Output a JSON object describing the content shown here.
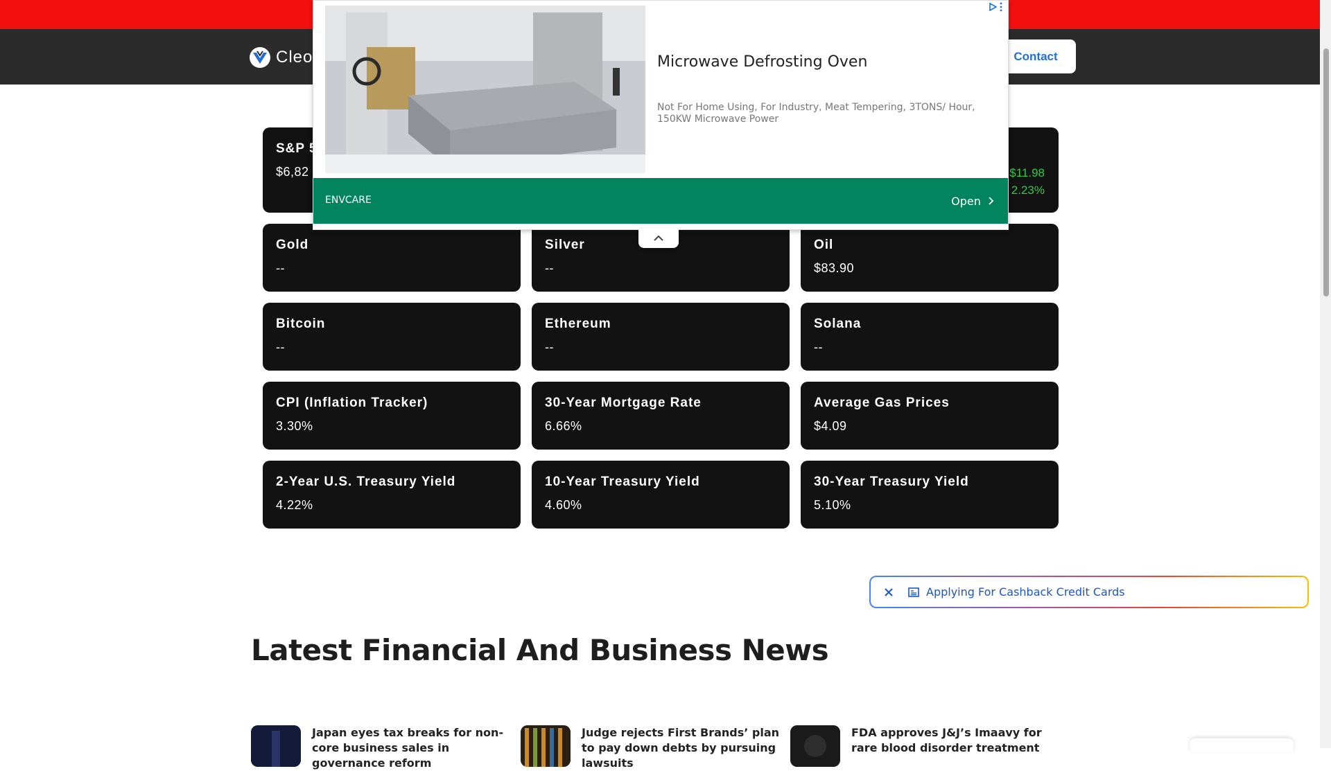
{
  "header": {
    "logo_text": "Cleo",
    "contact_label": "Contact"
  },
  "cards": [
    {
      "title": "S&P 5",
      "value": "$6,82",
      "change": ""
    },
    {
      "title": "",
      "value": "",
      "change": ""
    },
    {
      "title": "",
      "value": "",
      "change_line1": "$11.98",
      "change_line2": "2.23%"
    },
    {
      "title": "Gold",
      "value": "--"
    },
    {
      "title": "Silver",
      "value": "--"
    },
    {
      "title": "Oil",
      "value": "$83.90"
    },
    {
      "title": "Bitcoin",
      "value": "--"
    },
    {
      "title": "Ethereum",
      "value": "--"
    },
    {
      "title": "Solana",
      "value": "--"
    },
    {
      "title": "CPI (Inflation Tracker)",
      "value": "3.30%"
    },
    {
      "title": "30-Year Mortgage Rate",
      "value": "6.66%"
    },
    {
      "title": "Average Gas Prices",
      "value": "$4.09"
    },
    {
      "title": "2-Year U.S. Treasury Yield",
      "value": "4.22%"
    },
    {
      "title": "10-Year Treasury Yield",
      "value": "4.60%"
    },
    {
      "title": "30-Year Treasury Yield",
      "value": "5.10%"
    }
  ],
  "ad": {
    "title": "Microwave Defrosting Oven",
    "description": "Not For Home Using, For Industry, Meat Tempering, 3TONS/ Hour, 150KW Microwave Power",
    "brand": "ENVCARE",
    "open_label": "Open"
  },
  "suggestion": {
    "text": "Applying For Cashback Credit Cards"
  },
  "news": {
    "heading": "Latest Financial And Business News",
    "items": [
      {
        "headline": "Japan eyes tax breaks for non-core business sales in governance reform"
      },
      {
        "headline": "Judge rejects First Brands’ plan to pay down debts by pursuing lawsuits"
      },
      {
        "headline": "FDA approves J&J’s Imaavy for rare blood disorder treatment"
      }
    ]
  },
  "colors": {
    "topbar": "#f40f0f",
    "navbar": "#2b2b2b",
    "card_bg": "#121212",
    "positive": "#2ecc40",
    "ad_footer": "#02855f",
    "link_blue": "#1e6fd9"
  }
}
